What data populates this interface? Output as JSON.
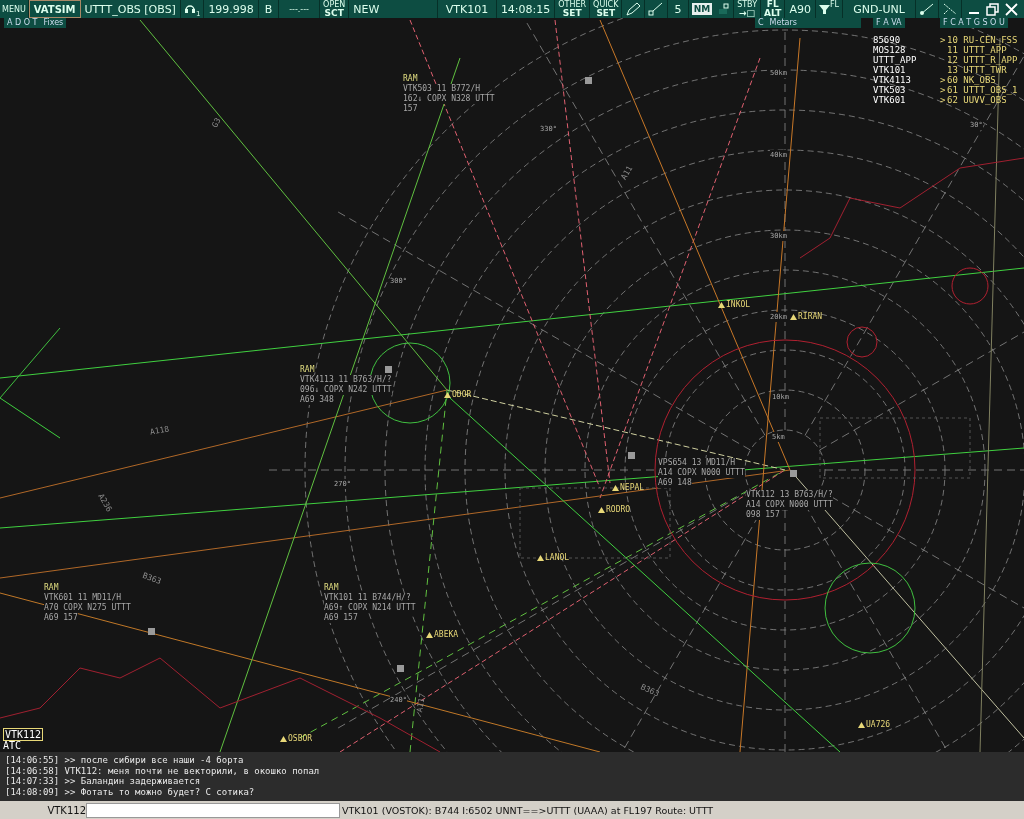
{
  "toolbar": {
    "menu_label": "MENU",
    "logo": "VATSIM",
    "callsign": "UTTT_OBS [OBS]",
    "headset_channel": "1",
    "frequency": "199.998",
    "atis_letter": "B",
    "secondary_frequency": "---.---",
    "open_sector": {
      "top": "OPEN",
      "bottom": "SCT"
    },
    "sector_status": "NEW",
    "selected_callsign": "VTK101",
    "clock": "14:08:15",
    "other_set": {
      "top": "OTHER",
      "bottom": "SET"
    },
    "quick_set": {
      "top": "QUICK",
      "bottom": "SET"
    },
    "range": "5",
    "unit": "NM",
    "stby": {
      "top": "STBY",
      "bottom": "→□"
    },
    "fl_alt": {
      "top": "FL",
      "bottom": "ALT"
    },
    "transition": "A90",
    "filter_label": "FL",
    "altitude_filter": "GND-UNL"
  },
  "panels": [
    {
      "tabs": "A D O T",
      "title": "Fixes"
    },
    {
      "tabs": "C",
      "title": "Metars"
    },
    {
      "tabs": "F A VA"
    },
    {
      "tabs": "F C A T G S O U"
    }
  ],
  "aircraft_list": [
    "85690",
    "MOS128",
    "UTTT_APP",
    "VTK101",
    "VTK4113",
    "VTK503",
    "VTK601"
  ],
  "atc_list": [
    {
      "mark": ">",
      "label": "10 RU-CEN_FSS"
    },
    {
      "label": "11 UTTT_APP"
    },
    {
      "label": "12 UTTT_R_APP"
    },
    {
      "label": "13 UTTT_TWR"
    },
    {
      "mark": ">",
      "label": "60 NK_OBS"
    },
    {
      "mark": ">",
      "label": "61 UTTT_OBS_1"
    },
    {
      "mark": ">",
      "label": "62 UUVV_OBS"
    }
  ],
  "radar": {
    "range_labels": [
      "50km",
      "40km",
      "30km",
      "20km",
      "10km",
      "5km"
    ],
    "bearing_labels": [
      "330°",
      "300°",
      "270°",
      "240°",
      "30°"
    ],
    "waypoints": [
      "INKOL",
      "RIRAN",
      "ODOR",
      "NEPAL",
      "RODRO",
      "LANOL",
      "ABEKA",
      "OSBOR",
      "UA726"
    ],
    "airway_labels": [
      "G3",
      "A118",
      "A236",
      "B363",
      "A117",
      "B363",
      "A11"
    ],
    "targets": [
      {
        "tag": "RAM",
        "lines": [
          "VTK503 11 B772/H",
          "162↓ COPX N328 UTTT",
          "157"
        ]
      },
      {
        "tag": "RAM",
        "lines": [
          "VTK4113 11 B763/H/?",
          "096↓ COPX N242 UTTT",
          "A69 348"
        ]
      },
      {
        "tag": "RAM",
        "lines": [
          "VTK601 11 MD11/H",
          "A70 COPX N275 UTTT",
          "A69 157"
        ]
      },
      {
        "tag": "RAM",
        "lines": [
          "VTK101 11 B744/H/?",
          "A69↑ COPX N214 UTTT",
          "A69 157"
        ]
      },
      {
        "lines": [
          "VPS654 13 MD11/H",
          "A14 COPX N000 UTTT",
          "A69 148"
        ]
      },
      {
        "lines": [
          "VTK112 13 B763/H/?",
          "A14 COPX N000 UTTT",
          "098 157"
        ]
      }
    ]
  },
  "selected_tag": {
    "callsign": "VTK112",
    "type": "ATC"
  },
  "chat": [
    "[14:06:55] >> после сибири все наши -4 борта",
    "[14:06:58] VTK112: меня почти не векторили, в окошко попал",
    "[14:07:33] >> Баландин задерживается",
    "[14:08:09] >> Фотать то можно будет? С сотика?"
  ],
  "command_line": {
    "prefix": "VTK112"
  },
  "flight_info": "VTK101 (VOSTOK): B744 I:6502 UNNT==>UTTT (UAAA) at FL197 Route: UTTT"
}
